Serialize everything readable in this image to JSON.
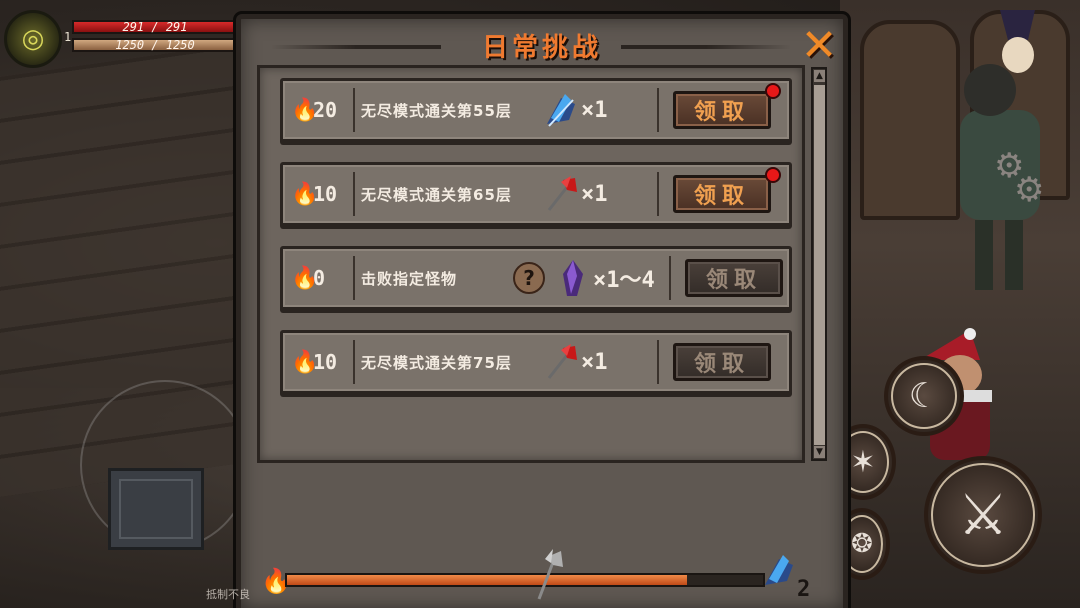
{
  "hud": {
    "level": "1",
    "hp": "291 / 291",
    "mp": "1250 / 1250"
  },
  "panel": {
    "title": "日常挑战",
    "close_icon": "close-x-icon"
  },
  "challenges": [
    {
      "points": "20",
      "task": "无尽模式通关第55层",
      "reward_icon": "blue-claw-gauntlet-icon",
      "reward_qty": "×1",
      "claim_label": "领取",
      "claimable": true,
      "badge": true
    },
    {
      "points": "10",
      "task": "无尽模式通关第65层",
      "reward_icon": "red-battle-axe-icon",
      "reward_qty": "×1",
      "claim_label": "领取",
      "claimable": true,
      "badge": true
    },
    {
      "points": "0",
      "task": "击败指定怪物",
      "reward_icon": "purple-crystal-icon",
      "reward_qty": "×1～4",
      "claim_label": "领取",
      "claimable": false,
      "badge": false,
      "has_hint": true,
      "hint_symbol": "?"
    },
    {
      "points": "10",
      "task": "无尽模式通关第75层",
      "reward_icon": "red-battle-axe-icon",
      "reward_qty": "×1",
      "claim_label": "领取",
      "claimable": false,
      "badge": false
    }
  ],
  "progress": {
    "fraction": 0.84,
    "milestone_icon": "silver-battle-axe-icon",
    "final_icon": "blue-claw-gauntlet-icon",
    "final_count": "2"
  },
  "watermark": "抵制不良"
}
